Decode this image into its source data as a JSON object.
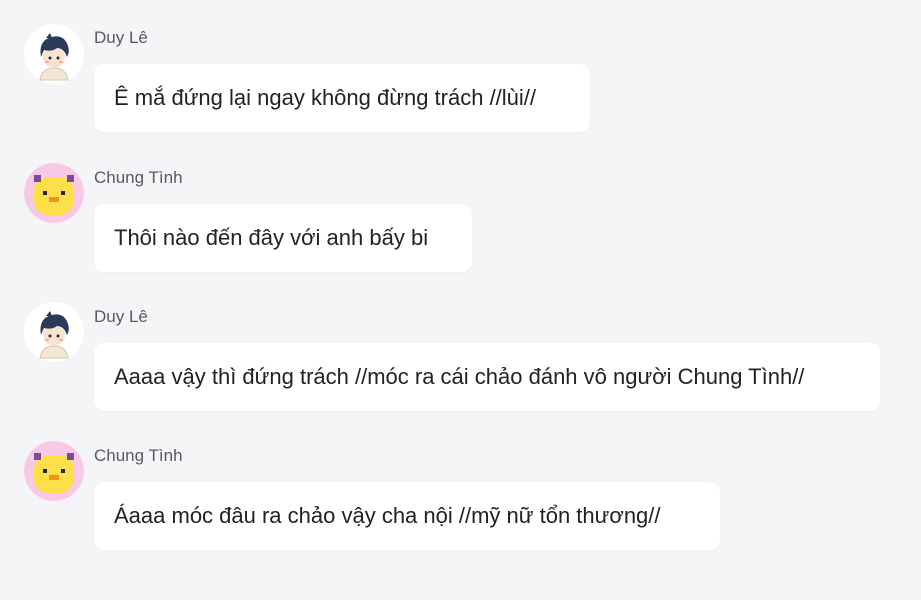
{
  "messages": [
    {
      "sender": "Duy Lê",
      "avatar": "boy-avatar-icon",
      "text": "Ê mắ đứng lại ngay không đừng trách //lùi//"
    },
    {
      "sender": "Chung Tình",
      "avatar": "duck-avatar-icon",
      "text": "Thôi nào đến đây với anh bấy bi"
    },
    {
      "sender": "Duy Lê",
      "avatar": "boy-avatar-icon",
      "text": "Aaaa vậy thì đứng trách //móc ra cái chảo đánh vô người Chung Tình//"
    },
    {
      "sender": "Chung Tình",
      "avatar": "duck-avatar-icon",
      "text": "Áaaa móc đâu ra chảo vậy cha nội //mỹ nữ tổn thương//"
    }
  ],
  "colors": {
    "background": "#f5f5f7",
    "bubble": "#ffffff",
    "sender_name": "#555b66",
    "message_text": "#222222"
  }
}
